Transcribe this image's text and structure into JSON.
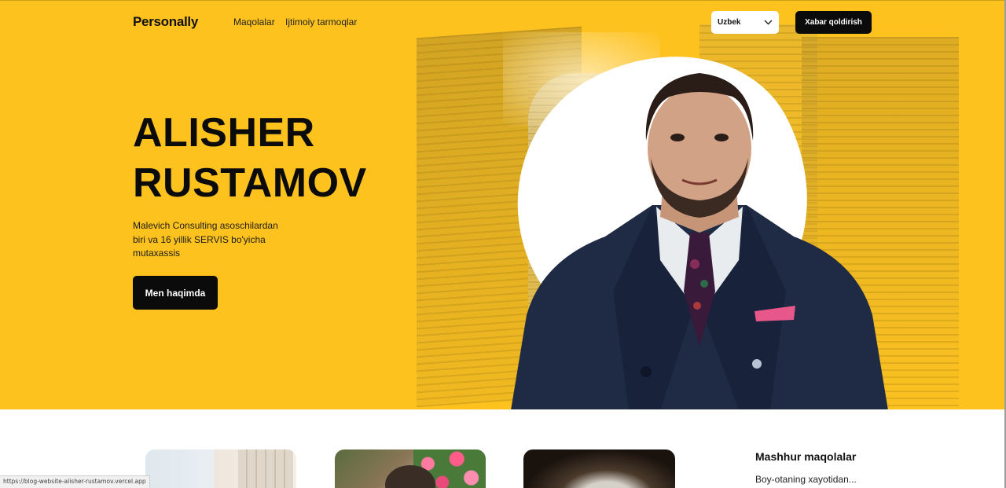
{
  "header": {
    "logo": "Personally",
    "nav": [
      "Maqolalar",
      "Ijtimoiy tarmoqlar"
    ],
    "language": {
      "selected": "Uzbek",
      "icon": "chevron-down-icon"
    },
    "cta_label": "Xabar qoldirish"
  },
  "hero": {
    "name_line1": "ALISHER",
    "name_line2": "RUSTAMOV",
    "description": "Malevich Consulting asoschilardan biri va 16 yillik SERVIS bo'yicha mutaxassis",
    "button_label": "Men haqimda",
    "background_color": "#fec21e"
  },
  "articles": {
    "popular_title": "Mashhur maqolalar",
    "popular_items": [
      "Boy-otaning xayotidan..."
    ]
  },
  "status_bar": {
    "url": "https://blog-website-alisher-rustamov.vercel.app"
  },
  "colors": {
    "accent": "#fec21e",
    "button": "#0b0b0b",
    "button_text": "#ffffff"
  }
}
